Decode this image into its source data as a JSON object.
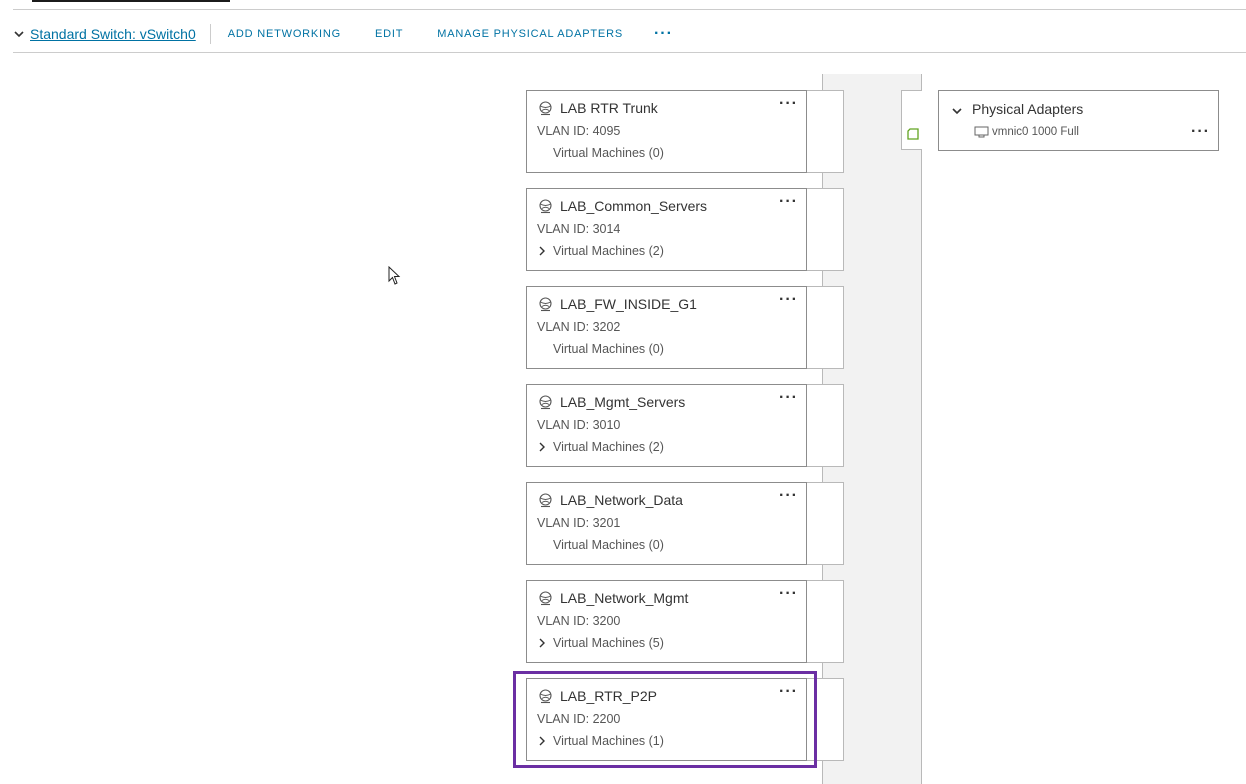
{
  "header": {
    "switch_title": "Standard Switch: vSwitch0",
    "actions": {
      "add_networking": "ADD NETWORKING",
      "edit": "EDIT",
      "manage_adapters": "MANAGE PHYSICAL ADAPTERS",
      "more": "···"
    }
  },
  "port_groups": [
    {
      "name": "LAB RTR Trunk",
      "vlan": "VLAN ID: 4095",
      "vms": "Virtual Machines (0)",
      "expandable": false
    },
    {
      "name": "LAB_Common_Servers",
      "vlan": "VLAN ID: 3014",
      "vms": "Virtual Machines (2)",
      "expandable": true
    },
    {
      "name": "LAB_FW_INSIDE_G1",
      "vlan": "VLAN ID: 3202",
      "vms": "Virtual Machines (0)",
      "expandable": false
    },
    {
      "name": "LAB_Mgmt_Servers",
      "vlan": "VLAN ID: 3010",
      "vms": "Virtual Machines (2)",
      "expandable": true
    },
    {
      "name": "LAB_Network_Data",
      "vlan": "VLAN ID: 3201",
      "vms": "Virtual Machines (0)",
      "expandable": false
    },
    {
      "name": "LAB_Network_Mgmt",
      "vlan": "VLAN ID: 3200",
      "vms": "Virtual Machines (5)",
      "expandable": true
    },
    {
      "name": "LAB_RTR_P2P",
      "vlan": "VLAN ID: 2200",
      "vms": "Virtual Machines (1)",
      "expandable": true,
      "highlighted": true
    }
  ],
  "card_more": "···",
  "physical_adapters": {
    "title": "Physical Adapters",
    "nic": "vmnic0 1000 Full",
    "more": "···"
  },
  "colors": {
    "link": "#0072a3",
    "highlight": "#6b2fa3",
    "port_active": "#62a420"
  }
}
